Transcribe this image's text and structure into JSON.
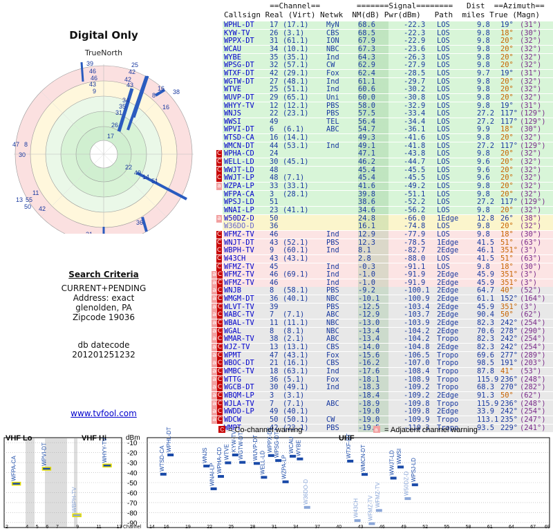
{
  "polar": {
    "title": "Digital Only",
    "north_label": "TrueNorth",
    "labels": [
      "39",
      "46",
      "46",
      "43",
      "9",
      "25",
      "42",
      "42",
      "43",
      "38",
      "16",
      "8",
      "34",
      "35",
      "16",
      "31",
      "26",
      "17",
      "47",
      "8",
      "30",
      "22",
      "49",
      "14",
      "51",
      "36",
      "11",
      "13",
      "55",
      "50",
      "42",
      "21"
    ]
  },
  "criteria": {
    "heading": "Search Criteria",
    "line1": "CURRENT+PENDING",
    "line2": "Address: exact",
    "line3": "glenolden, PA",
    "line4": "Zipcode 19036",
    "db_label": "db datecode",
    "db_value": "201201251232",
    "link": "www.tvfool.com"
  },
  "header": {
    "line1": "          ==Channel==        =======Signal========   Dist  ==Azimuth==",
    "line2": "Callsign Real (Virt) Netwk  NM(dB) Pwr(dBm)   Path  miles True (Magn)"
  },
  "stations": [
    {
      "call": "WPHL-DT",
      "real": "17",
      "virt": "(17.1)",
      "net": "MyN",
      "nm": "68.6",
      "pwr": "-22.3",
      "path": "LOS",
      "dist": "9.8",
      "az": "19°",
      "mag": "(31°)",
      "bg": "#d8f5d8",
      "w": "",
      "c": "#0000cc"
    },
    {
      "call": "KYW-TV",
      "real": "26",
      "virt": "(3.1)",
      "net": "CBS",
      "nm": "68.5",
      "pwr": "-22.3",
      "path": "LOS",
      "dist": "9.8",
      "az": "18°",
      "mag": "(30°)",
      "bg": "#d8f5d8",
      "w": "",
      "c": "#0000cc"
    },
    {
      "call": "WPPX-DT",
      "real": "31",
      "virt": "(61.1)",
      "net": "ION",
      "nm": "67.9",
      "pwr": "-22.9",
      "path": "LOS",
      "dist": "9.8",
      "az": "20°",
      "mag": "(32°)",
      "bg": "#d8f5d8",
      "w": "",
      "c": "#0000cc"
    },
    {
      "call": "WCAU",
      "real": "34",
      "virt": "(10.1)",
      "net": "NBC",
      "nm": "67.3",
      "pwr": "-23.6",
      "path": "LOS",
      "dist": "9.8",
      "az": "20°",
      "mag": "(32°)",
      "bg": "#d8f5d8",
      "w": "",
      "c": "#0000cc"
    },
    {
      "call": "WYBE",
      "real": "35",
      "virt": "(35.1)",
      "net": "Ind",
      "nm": "64.3",
      "pwr": "-26.3",
      "path": "LOS",
      "dist": "9.8",
      "az": "20°",
      "mag": "(32°)",
      "bg": "#d8f5d8",
      "w": "",
      "c": "#0000cc"
    },
    {
      "call": "WPSG-DT",
      "real": "32",
      "virt": "(57.1)",
      "net": "CW",
      "nm": "62.9",
      "pwr": "-27.9",
      "path": "LOS",
      "dist": "9.8",
      "az": "20°",
      "mag": "(32°)",
      "bg": "#d8f5d8",
      "w": "",
      "c": "#0000cc"
    },
    {
      "call": "WTXF-DT",
      "real": "42",
      "virt": "(29.1)",
      "net": "Fox",
      "nm": "62.4",
      "pwr": "-28.5",
      "path": "LOS",
      "dist": "9.7",
      "az": "19°",
      "mag": "(31°)",
      "bg": "#d8f5d8",
      "w": "",
      "c": "#0000cc"
    },
    {
      "call": "WGTW-DT",
      "real": "27",
      "virt": "(48.1)",
      "net": "Ind",
      "nm": "61.1",
      "pwr": "-29.7",
      "path": "LOS",
      "dist": "9.8",
      "az": "20°",
      "mag": "(32°)",
      "bg": "#d8f5d8",
      "w": "",
      "c": "#0000cc"
    },
    {
      "call": "WTVE",
      "real": "25",
      "virt": "(51.1)",
      "net": "Ind",
      "nm": "60.6",
      "pwr": "-30.2",
      "path": "LOS",
      "dist": "9.8",
      "az": "20°",
      "mag": "(32°)",
      "bg": "#d8f5d8",
      "w": "",
      "c": "#0000cc"
    },
    {
      "call": "WUVP-DT",
      "real": "29",
      "virt": "(65.1)",
      "net": "Uni",
      "nm": "60.0",
      "pwr": "-30.8",
      "path": "LOS",
      "dist": "9.8",
      "az": "20°",
      "mag": "(32°)",
      "bg": "#d8f5d8",
      "w": "",
      "c": "#0000cc"
    },
    {
      "call": "WHYY-TV",
      "real": "12",
      "virt": "(12.1)",
      "net": "PBS",
      "nm": "58.0",
      "pwr": "-32.9",
      "path": "LOS",
      "dist": "9.8",
      "az": "19°",
      "mag": "(31°)",
      "bg": "#d8f5d8",
      "w": "",
      "c": "#0000cc"
    },
    {
      "call": "WNJS",
      "real": "22",
      "virt": "(23.1)",
      "net": "PBS",
      "nm": "57.5",
      "pwr": "-33.4",
      "path": "LOS",
      "dist": "27.2",
      "az": "117°",
      "mag": "(129°)",
      "bg": "#d8f5d8",
      "w": "",
      "c": "#0000cc"
    },
    {
      "call": "WWSI",
      "real": "49",
      "virt": "",
      "net": "TEL",
      "nm": "56.4",
      "pwr": "-34.4",
      "path": "LOS",
      "dist": "27.2",
      "az": "117°",
      "mag": "(129°)",
      "bg": "#d8f5d8",
      "w": "",
      "c": "#0000cc"
    },
    {
      "call": "WPVI-DT",
      "real": "6",
      "virt": "(6.1)",
      "net": "ABC",
      "nm": "54.7",
      "pwr": "-36.1",
      "path": "LOS",
      "dist": "9.9",
      "az": "18°",
      "mag": "(30°)",
      "bg": "#d8f5d8",
      "w": "",
      "c": "#0000cc"
    },
    {
      "call": "WTSD-CA",
      "real": "16",
      "virt": "(14.1)",
      "net": "",
      "nm": "49.3",
      "pwr": "-41.6",
      "path": "LOS",
      "dist": "9.8",
      "az": "20°",
      "mag": "(32°)",
      "bg": "#d8f5d8",
      "w": "",
      "c": "#0000cc"
    },
    {
      "call": "WMCN-DT",
      "real": "44",
      "virt": "(53.1)",
      "net": "Ind",
      "nm": "49.1",
      "pwr": "-41.8",
      "path": "LOS",
      "dist": "27.2",
      "az": "117°",
      "mag": "(129°)",
      "bg": "#d8f5d8",
      "w": "",
      "c": "#0000cc"
    },
    {
      "call": "WPHA-CD",
      "real": "24",
      "virt": "",
      "net": "",
      "nm": "47.1",
      "pwr": "-43.8",
      "path": "LOS",
      "dist": "9.8",
      "az": "20°",
      "mag": "(32°)",
      "bg": "#d8f5d8",
      "w": "C",
      "c": "#0000cc"
    },
    {
      "call": "WELL-LD",
      "real": "30",
      "virt": "(45.1)",
      "net": "",
      "nm": "46.2",
      "pwr": "-44.7",
      "path": "LOS",
      "dist": "9.6",
      "az": "20°",
      "mag": "(32°)",
      "bg": "#d8f5d8",
      "w": "C",
      "c": "#0000cc"
    },
    {
      "call": "WWJT-LD",
      "real": "48",
      "virt": "",
      "net": "",
      "nm": "45.4",
      "pwr": "-45.5",
      "path": "LOS",
      "dist": "9.6",
      "az": "20°",
      "mag": "(32°)",
      "bg": "#d8f5d8",
      "w": "C",
      "c": "#0000cc"
    },
    {
      "call": "WWJT-LP",
      "real": "48",
      "virt": "(7.1)",
      "net": "",
      "nm": "45.4",
      "pwr": "-45.5",
      "path": "LOS",
      "dist": "9.6",
      "az": "20°",
      "mag": "(32°)",
      "bg": "#d8f5d8",
      "w": "C",
      "c": "#0000cc"
    },
    {
      "call": "WZPA-LP",
      "real": "33",
      "virt": "(33.1)",
      "net": "",
      "nm": "41.6",
      "pwr": "-49.2",
      "path": "LOS",
      "dist": "9.8",
      "az": "20°",
      "mag": "(32°)",
      "bg": "#d8f5d8",
      "w": "a",
      "c": "#0000cc"
    },
    {
      "call": "WFPA-CA",
      "real": "3",
      "virt": "(28.1)",
      "net": "",
      "nm": "39.8",
      "pwr": "-51.1",
      "path": "LOS",
      "dist": "9.8",
      "az": "20°",
      "mag": "(32°)",
      "bg": "#d8f5d8",
      "w": "",
      "c": "#0000cc"
    },
    {
      "call": "WPSJ-LD",
      "real": "51",
      "virt": "",
      "net": "",
      "nm": "38.6",
      "pwr": "-52.2",
      "path": "LOS",
      "dist": "27.2",
      "az": "117°",
      "mag": "(129°)",
      "bg": "#d8f5d8",
      "w": "",
      "c": "#0000cc"
    },
    {
      "call": "WNAI-LP",
      "real": "23",
      "virt": "(41.1)",
      "net": "",
      "nm": "34.6",
      "pwr": "-56.2",
      "path": "LOS",
      "dist": "9.8",
      "az": "20°",
      "mag": "(32°)",
      "bg": "#d8f5d8",
      "w": "",
      "c": "#0000cc"
    },
    {
      "call": "W50DZ-D",
      "real": "50",
      "virt": "",
      "net": "",
      "nm": "24.8",
      "pwr": "-66.0",
      "path": "1Edge",
      "dist": "12.8",
      "az": "26°",
      "mag": "(38°)",
      "bg": "#fbf5cc",
      "w": "a",
      "c": "#0000cc"
    },
    {
      "call": "W36DO-D",
      "real": "36",
      "virt": "",
      "net": "",
      "nm": "16.1",
      "pwr": "-74.8",
      "path": "LOS",
      "dist": "9.8",
      "az": "20°",
      "mag": "(32°)",
      "bg": "#fbf5cc",
      "w": "",
      "c": "#6666cc"
    },
    {
      "call": "WFMZ-TV",
      "real": "46",
      "virt": "",
      "net": "Ind",
      "nm": "12.9",
      "pwr": "-77.9",
      "path": "LOS",
      "dist": "9.8",
      "az": "18°",
      "mag": "(30°)",
      "bg": "#fce4e4",
      "w": "C",
      "c": "#0000cc"
    },
    {
      "call": "WNJT-DT",
      "real": "43",
      "virt": "(52.1)",
      "net": "PBS",
      "nm": "12.3",
      "pwr": "-78.5",
      "path": "1Edge",
      "dist": "41.5",
      "az": "51°",
      "mag": "(63°)",
      "bg": "#fce4e4",
      "w": "C",
      "c": "#0000cc"
    },
    {
      "call": "WBPH-TV",
      "real": "9",
      "virt": "(60.1)",
      "net": "Ind",
      "nm": "8.1",
      "pwr": "-82.7",
      "path": "2Edge",
      "dist": "46.1",
      "az": "351°",
      "mag": "(3°)",
      "bg": "#fce4e4",
      "w": "C",
      "c": "#0000cc"
    },
    {
      "call": "W43CH",
      "real": "43",
      "virt": "(43.1)",
      "net": "",
      "nm": "2.8",
      "pwr": "-88.0",
      "path": "LOS",
      "dist": "41.5",
      "az": "51°",
      "mag": "(63°)",
      "bg": "#fce4e4",
      "w": "C",
      "c": "#0000cc"
    },
    {
      "call": "WFMZ-TV",
      "real": "45",
      "virt": "",
      "net": "Ind",
      "nm": "-0.3",
      "pwr": "-91.1",
      "path": "LOS",
      "dist": "9.8",
      "az": "18°",
      "mag": "(30°)",
      "bg": "#fce4e4",
      "w": "C",
      "c": "#0000cc"
    },
    {
      "call": "WFMZ-TV",
      "real": "46",
      "virt": "(69.1)",
      "net": "Ind",
      "nm": "-1.0",
      "pwr": "-91.9",
      "path": "2Edge",
      "dist": "45.9",
      "az": "351°",
      "mag": "(3°)",
      "bg": "#fce4e4",
      "w": "aC",
      "c": "#0000cc"
    },
    {
      "call": "WFMZ-TV",
      "real": "46",
      "virt": "",
      "net": "Ind",
      "nm": "-1.0",
      "pwr": "-91.9",
      "path": "2Edge",
      "dist": "45.9",
      "az": "351°",
      "mag": "(3°)",
      "bg": "#fce4e4",
      "w": "aC",
      "c": "#0000cc"
    },
    {
      "call": "WNJB",
      "real": "8",
      "virt": "(58.1)",
      "net": "PBS",
      "nm": "-9.2",
      "pwr": "-100.1",
      "path": "2Edge",
      "dist": "64.7",
      "az": "40°",
      "mag": "(52°)",
      "bg": "#e8e8e8",
      "w": "aC",
      "c": "#0000cc"
    },
    {
      "call": "WMGM-DT",
      "real": "36",
      "virt": "(40.1)",
      "net": "NBC",
      "nm": "-10.1",
      "pwr": "-100.9",
      "path": "2Edge",
      "dist": "61.1",
      "az": "152°",
      "mag": "(164°)",
      "bg": "#e8e8e8",
      "w": "aC",
      "c": "#0000cc"
    },
    {
      "call": "WLVT-TV",
      "real": "39",
      "virt": "",
      "net": "PBS",
      "nm": "-12.5",
      "pwr": "-103.4",
      "path": "2Edge",
      "dist": "45.9",
      "az": "351°",
      "mag": "(3°)",
      "bg": "#e8e8e8",
      "w": "aC",
      "c": "#0000cc"
    },
    {
      "call": "WABC-TV",
      "real": "7",
      "virt": "(7.1)",
      "net": "ABC",
      "nm": "-12.9",
      "pwr": "-103.7",
      "path": "2Edge",
      "dist": "90.4",
      "az": "50°",
      "mag": "(62°)",
      "bg": "#e8e8e8",
      "w": "aC",
      "c": "#0000cc"
    },
    {
      "call": "WBAL-TV",
      "real": "11",
      "virt": "(11.1)",
      "net": "NBC",
      "nm": "-13.0",
      "pwr": "-103.9",
      "path": "2Edge",
      "dist": "82.3",
      "az": "242°",
      "mag": "(254°)",
      "bg": "#e8e8e8",
      "w": "aC",
      "c": "#0000cc"
    },
    {
      "call": "WGAL",
      "real": "8",
      "virt": "(8.1)",
      "net": "NBC",
      "nm": "-13.4",
      "pwr": "-104.2",
      "path": "2Edge",
      "dist": "70.6",
      "az": "278°",
      "mag": "(290°)",
      "bg": "#e8e8e8",
      "w": "aC",
      "c": "#0000cc"
    },
    {
      "call": "WMAR-TV",
      "real": "38",
      "virt": "(2.1)",
      "net": "ABC",
      "nm": "-13.4",
      "pwr": "-104.2",
      "path": "Tropo",
      "dist": "82.3",
      "az": "242°",
      "mag": "(254°)",
      "bg": "#e8e8e8",
      "w": "aC",
      "c": "#0000cc"
    },
    {
      "call": "WJZ-TV",
      "real": "13",
      "virt": "(13.1)",
      "net": "CBS",
      "nm": "-14.0",
      "pwr": "-104.8",
      "path": "2Edge",
      "dist": "82.3",
      "az": "242°",
      "mag": "(254°)",
      "bg": "#e8e8e8",
      "w": "aC",
      "c": "#0000cc"
    },
    {
      "call": "WPMT",
      "real": "47",
      "virt": "(43.1)",
      "net": "Fox",
      "nm": "-15.6",
      "pwr": "-106.5",
      "path": "Tropo",
      "dist": "69.6",
      "az": "277°",
      "mag": "(289°)",
      "bg": "#e8e8e8",
      "w": "aC",
      "c": "#0000cc"
    },
    {
      "call": "WBOC-DT",
      "real": "21",
      "virt": "(16.1)",
      "net": "CBS",
      "nm": "-16.2",
      "pwr": "-107.0",
      "path": "Tropo",
      "dist": "98.5",
      "az": "191°",
      "mag": "(203°)",
      "bg": "#e8e8e8",
      "w": "aC",
      "c": "#0000cc"
    },
    {
      "call": "WMBC-TV",
      "real": "18",
      "virt": "(63.1)",
      "net": "Ind",
      "nm": "-17.6",
      "pwr": "-108.4",
      "path": "Tropo",
      "dist": "87.8",
      "az": "41°",
      "mag": "(53°)",
      "bg": "#e8e8e8",
      "w": "aC",
      "c": "#0000cc"
    },
    {
      "call": "WTTG",
      "real": "36",
      "virt": "(5.1)",
      "net": "Fox",
      "nm": "-18.1",
      "pwr": "-108.9",
      "path": "Tropo",
      "dist": "115.9",
      "az": "236°",
      "mag": "(248°)",
      "bg": "#e8e8e8",
      "w": "aC",
      "c": "#0000cc"
    },
    {
      "call": "WGCB-DT",
      "real": "30",
      "virt": "(49.1)",
      "net": "Ind",
      "nm": "-18.3",
      "pwr": "-109.2",
      "path": "Tropo",
      "dist": "68.3",
      "az": "270°",
      "mag": "(282°)",
      "bg": "#e8e8e8",
      "w": "aC",
      "c": "#0000cc"
    },
    {
      "call": "WBQM-LP",
      "real": "3",
      "virt": "(3.1)",
      "net": "",
      "nm": "-18.4",
      "pwr": "-109.2",
      "path": "2Edge",
      "dist": "91.3",
      "az": "50°",
      "mag": "(62°)",
      "bg": "#e8e8e8",
      "w": "aC",
      "c": "#0000cc"
    },
    {
      "call": "WJLA-TV",
      "real": "7",
      "virt": "(7.1)",
      "net": "ABC",
      "nm": "-18.9",
      "pwr": "-109.8",
      "path": "Tropo",
      "dist": "115.9",
      "az": "236°",
      "mag": "(248°)",
      "bg": "#e8e8e8",
      "w": "aC",
      "c": "#0000cc"
    },
    {
      "call": "WWDD-LP",
      "real": "49",
      "virt": "(40.1)",
      "net": "",
      "nm": "-19.0",
      "pwr": "-109.8",
      "path": "2Edge",
      "dist": "33.9",
      "az": "242°",
      "mag": "(254°)",
      "bg": "#e8e8e8",
      "w": "aC",
      "c": "#0000cc"
    },
    {
      "call": "WDCW",
      "real": "50",
      "virt": "(50.1)",
      "net": "CW",
      "nm": "-19.0",
      "pwr": "-109.9",
      "path": "Tropo",
      "dist": "113.1",
      "az": "235°",
      "mag": "(247°)",
      "bg": "#e8e8e8",
      "w": "aC",
      "c": "#0000cc"
    },
    {
      "call": "WMPT",
      "real": "42",
      "virt": "(22.1)",
      "net": "PBS",
      "nm": "-19.5",
      "pwr": "-110.3",
      "path": "Tropo",
      "dist": "93.5",
      "az": "229°",
      "mag": "(241°)",
      "bg": "#e8e8e8",
      "w": "",
      "c": "#0000cc"
    }
  ],
  "chart": {
    "vhf_lo_label": "VHF Lo",
    "vhf_hi_label": "VHF Hi",
    "uhf_label": "UHF",
    "dbm_label": "dBm",
    "channel_label": "Channel",
    "legend_co": "= Co-channel warning",
    "legend_adj": "= Adjacent channel warning",
    "legend_co_box": "C",
    "legend_adj_box": "a",
    "y_ticks": [
      "-10",
      "-20",
      "-30",
      "-40",
      "-50",
      "-60",
      "-70",
      "-80",
      "-90"
    ]
  },
  "chart_data": {
    "type": "bar",
    "ylabel": "dBm",
    "xlabel": "Channel",
    "ylim": [
      -95,
      -5
    ],
    "vhf_ticks": [
      "2",
      "4",
      "5",
      "6",
      "7",
      "9",
      "11",
      "13"
    ],
    "uhf_ticks": [
      "14",
      "16",
      "19",
      "22",
      "25",
      "28",
      "31",
      "34",
      "37",
      "40",
      "43",
      "46",
      "49",
      "52",
      "55",
      "58",
      "61",
      "64",
      "67",
      "69"
    ],
    "points": [
      {
        "call": "WFPA-CA",
        "ch": 3,
        "dbm": -51.1
      },
      {
        "call": "WPVI-DT",
        "ch": 6,
        "dbm": -36.1
      },
      {
        "call": "WBPH-TV",
        "ch": 9,
        "dbm": -82.7
      },
      {
        "call": "WHYY-TV",
        "ch": 12,
        "dbm": -32.9
      },
      {
        "call": "WTSD-CA",
        "ch": 16,
        "dbm": -41.6
      },
      {
        "call": "WPHL-DT",
        "ch": 17,
        "dbm": -22.3
      },
      {
        "call": "WNJS",
        "ch": 22,
        "dbm": -33.4
      },
      {
        "call": "WNAI-LP",
        "ch": 23,
        "dbm": -56.2
      },
      {
        "call": "WPHA-CD",
        "ch": 24,
        "dbm": -43.8
      },
      {
        "call": "WTVE",
        "ch": 25,
        "dbm": -30.2
      },
      {
        "call": "KYW-TV",
        "ch": 26,
        "dbm": -22.3
      },
      {
        "call": "WGTW-DT",
        "ch": 27,
        "dbm": -29.7
      },
      {
        "call": "WUVP-DT",
        "ch": 29,
        "dbm": -30.8
      },
      {
        "call": "WELL-LD",
        "ch": 30,
        "dbm": -44.7
      },
      {
        "call": "WPPX-DT",
        "ch": 31,
        "dbm": -22.9
      },
      {
        "call": "WPSG-DT",
        "ch": 32,
        "dbm": -27.9
      },
      {
        "call": "WZPA-LP",
        "ch": 33,
        "dbm": -49.2
      },
      {
        "call": "WCAU",
        "ch": 34,
        "dbm": -23.6
      },
      {
        "call": "WYBE",
        "ch": 35,
        "dbm": -26.3
      },
      {
        "call": "W36DO-D",
        "ch": 36,
        "dbm": -74.8
      },
      {
        "call": "WTXF-DT",
        "ch": 42,
        "dbm": -28.5
      },
      {
        "call": "W43CH",
        "ch": 43,
        "dbm": -88.0
      },
      {
        "call": "WMCN-DT",
        "ch": 44,
        "dbm": -41.8
      },
      {
        "call": "WFMZ-TV",
        "ch": 45,
        "dbm": -91.1
      },
      {
        "call": "WFMZ-TV",
        "ch": 46,
        "dbm": -77.9
      },
      {
        "call": "WWJT-LD",
        "ch": 48,
        "dbm": -45.5
      },
      {
        "call": "WWSI",
        "ch": 49,
        "dbm": -34.4
      },
      {
        "call": "W50DZ-D",
        "ch": 50,
        "dbm": -66.0
      },
      {
        "call": "WPSJ-LD",
        "ch": 51,
        "dbm": -52.2
      }
    ]
  }
}
